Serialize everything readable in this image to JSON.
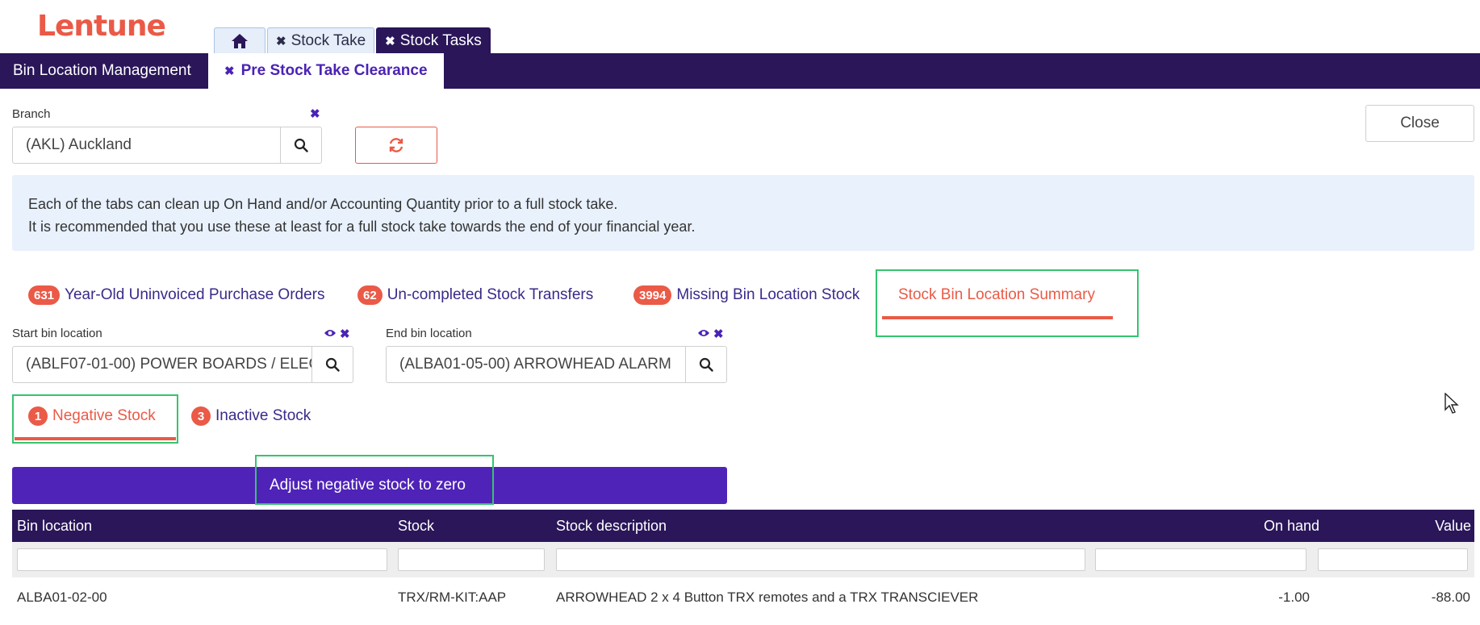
{
  "app": {
    "logo_text": "Lentune"
  },
  "top_tabs": [
    {
      "label": "",
      "icon": "home-icon"
    },
    {
      "label": "Stock Take"
    },
    {
      "label": "Stock Tasks"
    }
  ],
  "nav": {
    "item1": "Bin Location Management",
    "item2": "Pre Stock Take Clearance"
  },
  "branch": {
    "label": "Branch",
    "value": "(AKL) Auckland"
  },
  "close_label": "Close",
  "info": {
    "line1": "Each of the tabs can clean up On Hand and/or Accounting Quantity prior to a full stock take.",
    "line2": "It is recommended that you use these at least for a full stock take towards the end of your financial year."
  },
  "main_tabs": [
    {
      "count": "631",
      "label": "Year-Old Uninvoiced Purchase Orders"
    },
    {
      "count": "62",
      "label": "Un-completed Stock Transfers"
    },
    {
      "count": "3994",
      "label": "Missing Bin Location Stock"
    },
    {
      "count": "",
      "label": "Stock Bin Location Summary"
    }
  ],
  "start_bin": {
    "label": "Start bin location",
    "value": "(ABLF07-01-00) POWER BOARDS /  ELEC"
  },
  "end_bin": {
    "label": "End bin location",
    "value": "(ALBA01-05-00) ARROWHEAD ALARM"
  },
  "sub_tabs": [
    {
      "count": "1",
      "label": "Negative Stock"
    },
    {
      "count": "3",
      "label": "Inactive Stock"
    }
  ],
  "action": {
    "label": "Adjust negative stock to zero"
  },
  "table": {
    "headers": [
      "Bin location",
      "Stock",
      "Stock description",
      "On hand",
      "Value"
    ],
    "rows": [
      [
        "ALBA01-02-00",
        "TRX/RM-KIT:AAP",
        "ARROWHEAD 2 x 4 Button TRX remotes and a TRX TRANSCIEVER",
        "-1.00",
        "-88.00"
      ]
    ]
  },
  "colors": {
    "brand": "#ea5a47",
    "nav": "#2a1659",
    "accent": "#4f23b8",
    "highlight": "#36c46e"
  }
}
